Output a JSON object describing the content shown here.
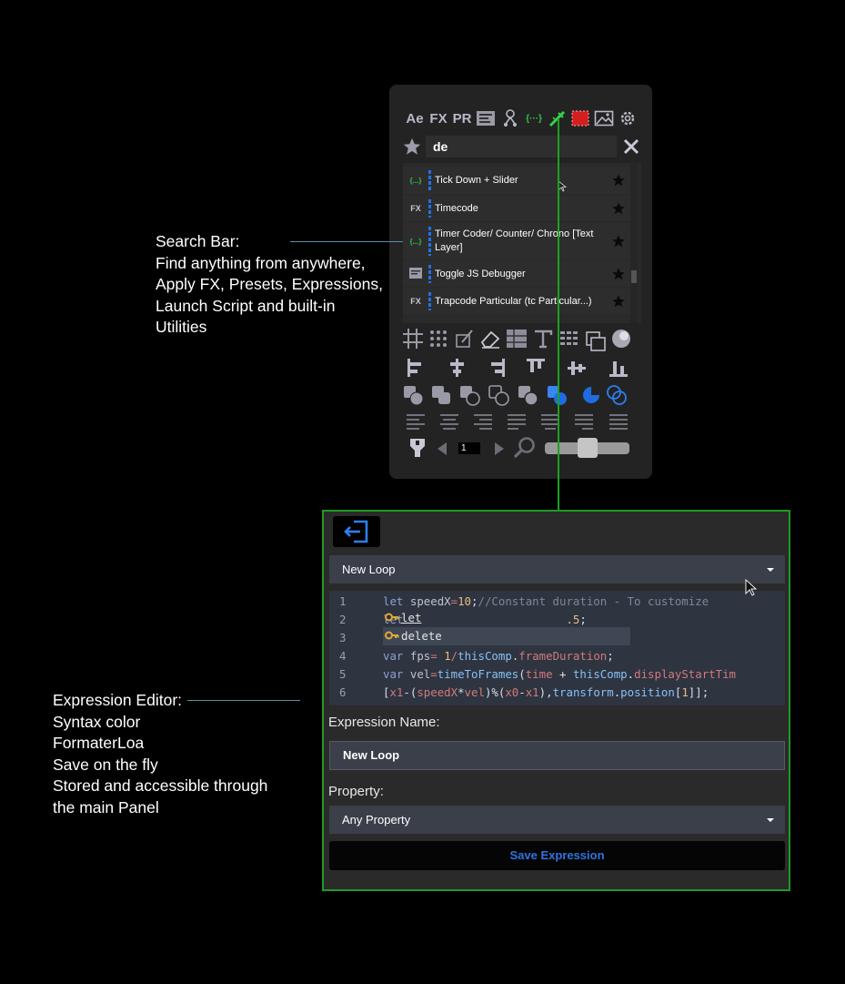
{
  "toolbar": {
    "items": [
      {
        "name": "ae-icon",
        "label": "Ae"
      },
      {
        "name": "fx-icon",
        "label": "FX"
      },
      {
        "name": "pr-icon",
        "label": "PR"
      }
    ]
  },
  "search": {
    "value": "de"
  },
  "results": [
    {
      "type": "expression",
      "type_label": "{...}",
      "label": "Tick Down + Slider"
    },
    {
      "type": "fx",
      "type_label": "FX",
      "label": "Timecode"
    },
    {
      "type": "expression",
      "type_label": "{...}",
      "label": "Timer Coder/ Counter/ Chrono [Text Layer]"
    },
    {
      "type": "script",
      "type_label": "",
      "label": "Toggle JS Debugger"
    },
    {
      "type": "fx",
      "type_label": "FX",
      "label": "Trapcode Particular (tc Particular...)"
    }
  ],
  "timeline": {
    "frame": "1",
    "slider_level": 0.5
  },
  "editor": {
    "expression_dropdown": "New Loop",
    "code_lines": [
      {
        "n": "1",
        "text": "let speedX=10;//Constant duration - To customize"
      },
      {
        "n": "2",
        "text": "let .5;"
      },
      {
        "n": "3",
        "text": ""
      },
      {
        "n": "4",
        "text": "var fps= 1/thisComp.frameDuration;"
      },
      {
        "n": "5",
        "text": "var vel=timeToFrames(time + thisComp.displayStartTim"
      },
      {
        "n": "6",
        "text": "[x1-(speedX*vel)%(x0-x1),transform.position[1]];"
      }
    ],
    "autocomplete": [
      "let",
      "delete"
    ],
    "name_label": "Expression Name:",
    "name_value": "New Loop",
    "property_label": "Property:",
    "property_value": "Any Property",
    "save_label": "Save Expression"
  },
  "callouts": {
    "search": [
      "Search Bar:",
      "Find anything from anywhere,",
      "Apply FX, Presets, Expressions,",
      "Launch Script and built-in",
      "Utilities"
    ],
    "editor": [
      "Expression Editor:",
      "Syntax color",
      "FormaterLoa",
      "Save on the fly",
      "Stored and accessible through",
      "the main Panel"
    ]
  },
  "colors": {
    "accent": "#1f72e8",
    "green": "#1ea11e",
    "panel": "#232323"
  }
}
